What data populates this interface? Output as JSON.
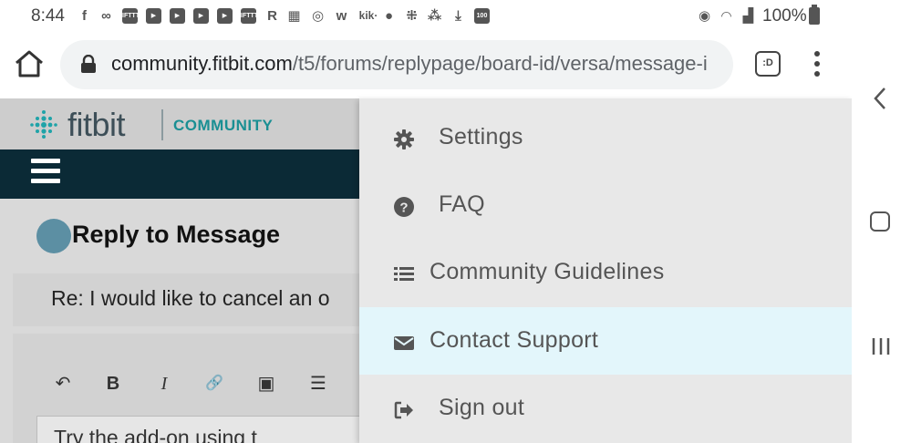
{
  "status_bar": {
    "time": "8:44",
    "battery": "100%",
    "icons": [
      "facebook-icon",
      "link-icon",
      "ifttt-icon",
      "youtube-icon",
      "youtube-icon",
      "youtube-icon",
      "youtube-icon",
      "ifttt-icon",
      "r-icon",
      "news-icon",
      "chrome-icon",
      "wish-icon",
      "kik-icon",
      "music-icon",
      "slack-icon",
      "fitbit-icon",
      "download-icon",
      "battery-100-icon",
      "hotspot-icon",
      "wifi-icon",
      "signal-icon",
      "battery-icon"
    ],
    "kik_label": "kik·",
    "ifttt_label": "IFTTT",
    "r_label": "R",
    "badge_label": "100"
  },
  "browser": {
    "url_domain": "community.fitbit.com",
    "url_path": "/t5/forums/replypage/board-id/versa/message-i",
    "tab_count": ":D"
  },
  "site": {
    "brand": "fitbit",
    "community_label": "COMMUNITY"
  },
  "page": {
    "title": "Reply to Message",
    "subject": "Re: I would like to cancel an o",
    "editor_text": "Try the add-on using t"
  },
  "editor_toolbar": [
    {
      "name": "undo-icon",
      "glyph": "↶"
    },
    {
      "name": "bold-icon",
      "glyph": "B"
    },
    {
      "name": "italic-icon",
      "glyph": "I"
    },
    {
      "name": "link-icon",
      "glyph": "🔗"
    },
    {
      "name": "image-icon",
      "glyph": "▣"
    },
    {
      "name": "list-icon",
      "glyph": "☰"
    }
  ],
  "menu": {
    "items": [
      {
        "label": "Settings",
        "icon": "gear-icon"
      },
      {
        "label": "FAQ",
        "icon": "question-icon"
      },
      {
        "label": "Community Guidelines",
        "icon": "list-icon"
      },
      {
        "label": "Contact Support",
        "icon": "envelope-icon",
        "active": true
      },
      {
        "label": "Sign out",
        "icon": "sign-out-icon"
      }
    ]
  },
  "colors": {
    "brand_teal": "#1a8f93",
    "nav_dark": "#0b2a36",
    "menu_active": "#e3f6fb"
  }
}
